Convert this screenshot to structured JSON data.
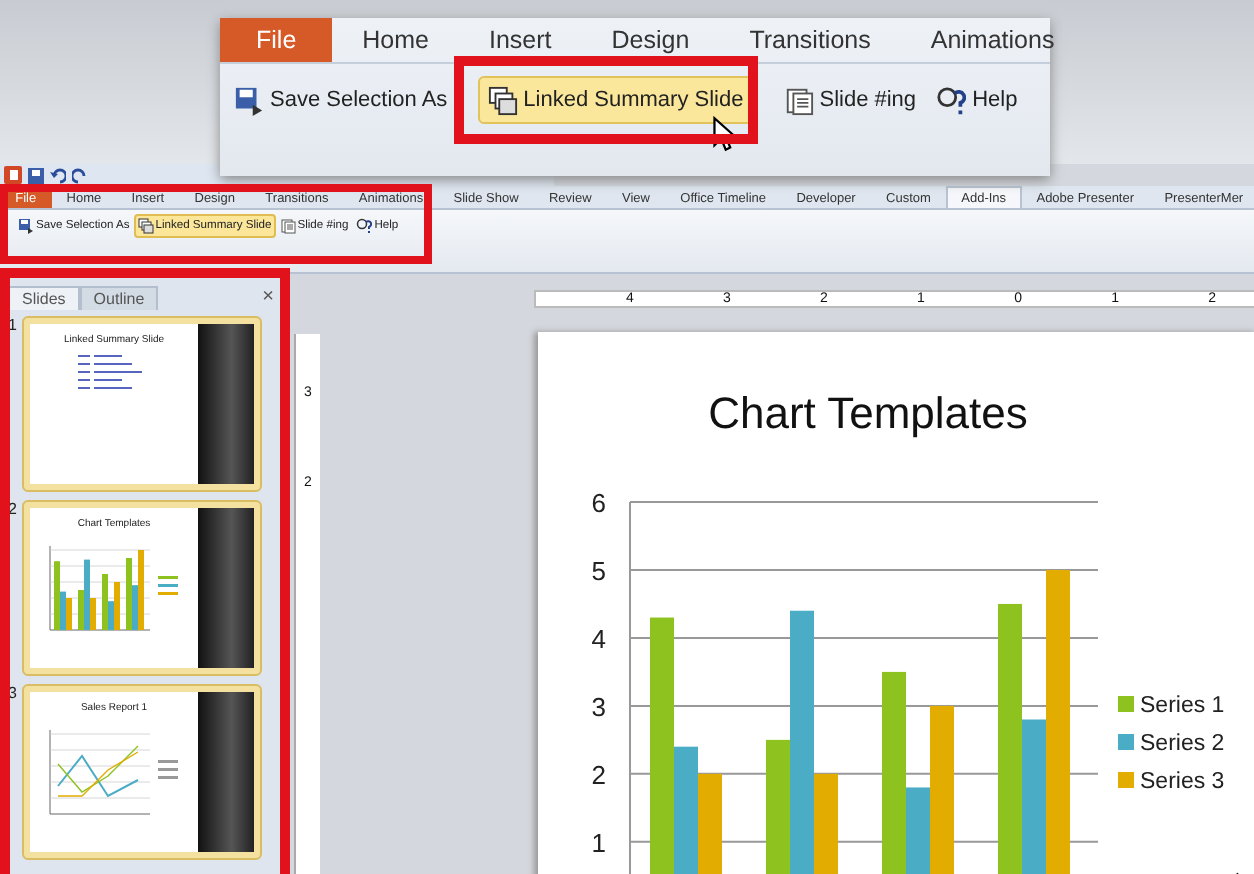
{
  "callout": {
    "tabs": [
      {
        "label": "File",
        "kind": "file"
      },
      {
        "label": "Home",
        "kind": "tab"
      },
      {
        "label": "Insert",
        "kind": "tab"
      },
      {
        "label": "Design",
        "kind": "tab"
      },
      {
        "label": "Transitions",
        "kind": "tab"
      },
      {
        "label": "Animations",
        "kind": "tab"
      }
    ],
    "buttons": [
      {
        "label": "Save Selection As",
        "kind": "save",
        "hovered": false
      },
      {
        "label": "Linked Summary Slide",
        "kind": "linked",
        "hovered": true
      },
      {
        "label": "Slide #ing",
        "kind": "numbering",
        "hovered": false
      },
      {
        "label": "Help",
        "kind": "help",
        "hovered": false
      }
    ]
  },
  "ribbon": {
    "tabs": [
      {
        "label": "File",
        "kind": "file",
        "selected": false
      },
      {
        "label": "Home",
        "kind": "tab",
        "selected": false
      },
      {
        "label": "Insert",
        "kind": "tab",
        "selected": false
      },
      {
        "label": "Design",
        "kind": "tab",
        "selected": false
      },
      {
        "label": "Transitions",
        "kind": "tab",
        "selected": false
      },
      {
        "label": "Animations",
        "kind": "tab",
        "selected": false
      },
      {
        "label": "Slide Show",
        "kind": "tab",
        "selected": false
      },
      {
        "label": "Review",
        "kind": "tab",
        "selected": false
      },
      {
        "label": "View",
        "kind": "tab",
        "selected": false
      },
      {
        "label": "Office Timeline",
        "kind": "tab",
        "selected": false
      },
      {
        "label": "Developer",
        "kind": "tab",
        "selected": false
      },
      {
        "label": "Custom",
        "kind": "tab",
        "selected": false
      },
      {
        "label": "Add-Ins",
        "kind": "tab",
        "selected": true
      },
      {
        "label": "Adobe Presenter",
        "kind": "tab",
        "selected": false
      },
      {
        "label": "PresenterMer",
        "kind": "tab",
        "selected": false
      }
    ],
    "buttons": [
      {
        "label": "Save Selection As",
        "kind": "save",
        "hovered": false
      },
      {
        "label": "Linked Summary Slide",
        "kind": "linked",
        "hovered": true
      },
      {
        "label": "Slide #ing",
        "kind": "numbering",
        "hovered": false
      },
      {
        "label": "Help",
        "kind": "help",
        "hovered": false
      }
    ]
  },
  "slides_pane": {
    "tabs": [
      {
        "label": "Slides",
        "selected": true
      },
      {
        "label": "Outline",
        "selected": false
      }
    ],
    "close": "×",
    "thumbnails": [
      {
        "number": "1",
        "title": "Linked Summary Slide",
        "kind": "links"
      },
      {
        "number": "2",
        "title": "Chart Templates",
        "kind": "bar"
      },
      {
        "number": "3",
        "title": "Sales Report 1",
        "kind": "line"
      }
    ]
  },
  "rulers": {
    "horizontal": [
      "4",
      "3",
      "2",
      "1",
      "0",
      "1",
      "2"
    ],
    "vertical": [
      "3",
      "2"
    ]
  },
  "slide": {
    "title": "Chart Templates",
    "chart_data": {
      "type": "bar",
      "ylim": [
        0.35,
        6
      ],
      "yticks": [
        1,
        2,
        3,
        4,
        5,
        6
      ],
      "grid": true,
      "legend": true,
      "series": [
        {
          "name": "Series 1",
          "color": "#8dc21f",
          "values": [
            4.3,
            2.5,
            3.5,
            4.5
          ]
        },
        {
          "name": "Series 2",
          "color": "#4bacc6",
          "values": [
            2.4,
            4.4,
            1.8,
            2.8
          ]
        },
        {
          "name": "Series 3",
          "color": "#e2ac00",
          "values": [
            2,
            2,
            3,
            5
          ]
        }
      ]
    }
  }
}
